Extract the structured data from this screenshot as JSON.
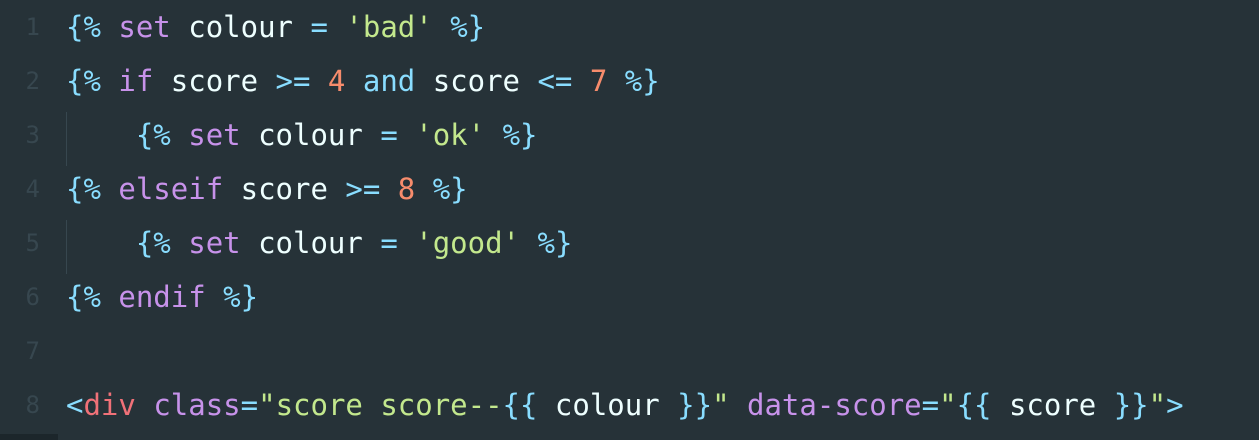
{
  "editor": {
    "line_numbers": [
      "1",
      "2",
      "3",
      "4",
      "5",
      "6",
      "7",
      "8"
    ],
    "lines": [
      {
        "tokens": [
          {
            "t": "{%",
            "c": "punct"
          },
          {
            "t": " ",
            "c": "var"
          },
          {
            "t": "set",
            "c": "kw"
          },
          {
            "t": " colour ",
            "c": "var"
          },
          {
            "t": "=",
            "c": "op"
          },
          {
            "t": " ",
            "c": "var"
          },
          {
            "t": "'bad'",
            "c": "str"
          },
          {
            "t": " ",
            "c": "var"
          },
          {
            "t": "%}",
            "c": "punct"
          }
        ]
      },
      {
        "tokens": [
          {
            "t": "{%",
            "c": "punct"
          },
          {
            "t": " ",
            "c": "var"
          },
          {
            "t": "if",
            "c": "kw"
          },
          {
            "t": " score ",
            "c": "var"
          },
          {
            "t": ">=",
            "c": "op"
          },
          {
            "t": " ",
            "c": "var"
          },
          {
            "t": "4",
            "c": "num"
          },
          {
            "t": " ",
            "c": "var"
          },
          {
            "t": "and",
            "c": "op"
          },
          {
            "t": " score ",
            "c": "var"
          },
          {
            "t": "<=",
            "c": "op"
          },
          {
            "t": " ",
            "c": "var"
          },
          {
            "t": "7",
            "c": "num"
          },
          {
            "t": " ",
            "c": "var"
          },
          {
            "t": "%}",
            "c": "punct"
          }
        ]
      },
      {
        "tokens": [
          {
            "t": "    ",
            "c": "var"
          },
          {
            "t": "{%",
            "c": "punct"
          },
          {
            "t": " ",
            "c": "var"
          },
          {
            "t": "set",
            "c": "kw"
          },
          {
            "t": " colour ",
            "c": "var"
          },
          {
            "t": "=",
            "c": "op"
          },
          {
            "t": " ",
            "c": "var"
          },
          {
            "t": "'ok'",
            "c": "str"
          },
          {
            "t": " ",
            "c": "var"
          },
          {
            "t": "%}",
            "c": "punct"
          }
        ]
      },
      {
        "tokens": [
          {
            "t": "{%",
            "c": "punct"
          },
          {
            "t": " ",
            "c": "var"
          },
          {
            "t": "elseif",
            "c": "kw"
          },
          {
            "t": " score ",
            "c": "var"
          },
          {
            "t": ">=",
            "c": "op"
          },
          {
            "t": " ",
            "c": "var"
          },
          {
            "t": "8",
            "c": "num"
          },
          {
            "t": " ",
            "c": "var"
          },
          {
            "t": "%}",
            "c": "punct"
          }
        ]
      },
      {
        "tokens": [
          {
            "t": "    ",
            "c": "var"
          },
          {
            "t": "{%",
            "c": "punct"
          },
          {
            "t": " ",
            "c": "var"
          },
          {
            "t": "set",
            "c": "kw"
          },
          {
            "t": " colour ",
            "c": "var"
          },
          {
            "t": "=",
            "c": "op"
          },
          {
            "t": " ",
            "c": "var"
          },
          {
            "t": "'good'",
            "c": "str"
          },
          {
            "t": " ",
            "c": "var"
          },
          {
            "t": "%}",
            "c": "punct"
          }
        ]
      },
      {
        "tokens": [
          {
            "t": "{%",
            "c": "punct"
          },
          {
            "t": " ",
            "c": "var"
          },
          {
            "t": "endif",
            "c": "kw"
          },
          {
            "t": " ",
            "c": "var"
          },
          {
            "t": "%}",
            "c": "punct"
          }
        ]
      },
      {
        "tokens": []
      },
      {
        "tokens": [
          {
            "t": "<",
            "c": "punct"
          },
          {
            "t": "div",
            "c": "tag"
          },
          {
            "t": " ",
            "c": "var"
          },
          {
            "t": "class",
            "c": "attr"
          },
          {
            "t": "=",
            "c": "punct"
          },
          {
            "t": "\"score score--",
            "c": "str"
          },
          {
            "t": "{{",
            "c": "punct"
          },
          {
            "t": " colour ",
            "c": "var"
          },
          {
            "t": "}}",
            "c": "punct"
          },
          {
            "t": "\"",
            "c": "str"
          },
          {
            "t": " ",
            "c": "var"
          },
          {
            "t": "data-score",
            "c": "attr"
          },
          {
            "t": "=",
            "c": "punct"
          },
          {
            "t": "\"",
            "c": "str"
          },
          {
            "t": "{{",
            "c": "punct"
          },
          {
            "t": " score ",
            "c": "var"
          },
          {
            "t": "}}",
            "c": "punct"
          },
          {
            "t": "\"",
            "c": "str"
          },
          {
            "t": ">",
            "c": "punct"
          }
        ]
      }
    ]
  },
  "colors": {
    "background": "#263238",
    "line_number": "#37474f",
    "punctuation": "#89ddff",
    "keyword": "#c792ea",
    "variable": "#eeffff",
    "string": "#c3e88d",
    "number": "#f78c6c",
    "tag": "#f07178"
  }
}
